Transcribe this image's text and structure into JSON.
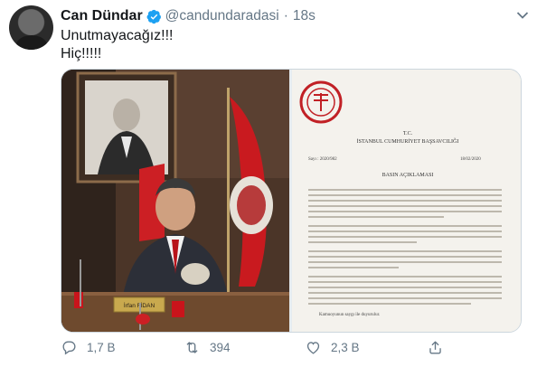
{
  "tweet": {
    "author_name": "Can Dündar",
    "handle": "@candundaradasi",
    "separator": "·",
    "time": "18s",
    "lines": [
      "Unutmayacağız!!!",
      "Hiç!!!!!"
    ]
  },
  "media": {
    "left_image": {
      "nameplate_line1": "İrfan FİDAN"
    },
    "right_image": {
      "doc_tc": "T.C.",
      "doc_office": "İSTANBUL CUMHURİYET BAŞSAVCILIĞI",
      "doc_number": "Sayı : 2020/982",
      "doc_date": "18/02/2020",
      "doc_title": "BASIN AÇIKLAMASI",
      "doc_closing": "Kamuoyunun saygı ile duyurulur."
    }
  },
  "actions": {
    "reply_count": "1,7 B",
    "retweet_count": "394",
    "like_count": "2,3 B"
  },
  "colors": {
    "text": "#14171a",
    "secondary": "#657786",
    "verified": "#1da1f2",
    "border": "#ccd6dd"
  }
}
